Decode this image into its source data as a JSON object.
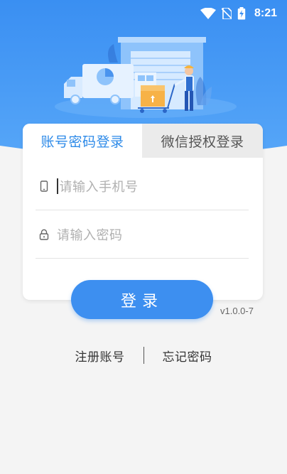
{
  "status_bar": {
    "time": "8:21"
  },
  "colors": {
    "brand": "#3d8ff0",
    "active_tab_text": "#2d8ae8"
  },
  "login_card": {
    "tabs": [
      {
        "label": "账号密码登录",
        "active": true
      },
      {
        "label": "微信授权登录",
        "active": false
      }
    ],
    "phone_field": {
      "icon": "phone-icon",
      "placeholder": "请输入手机号"
    },
    "password_field": {
      "icon": "lock-icon",
      "placeholder": "请输入密码"
    }
  },
  "login_button": {
    "label": "登录"
  },
  "version": "v1.0.0-7",
  "footer_links": {
    "register": "注册账号",
    "forgot": "忘记密码"
  }
}
